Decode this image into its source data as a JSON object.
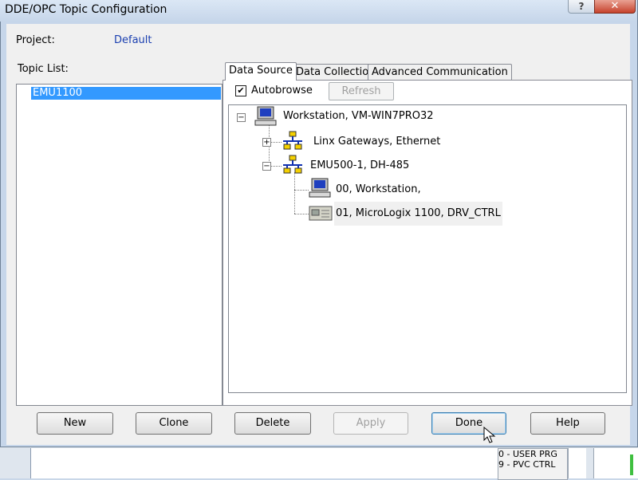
{
  "window": {
    "title": "DDE/OPC Topic Configuration",
    "help_glyph": "?",
    "close_glyph": "✕"
  },
  "project": {
    "label": "Project:",
    "value": "Default"
  },
  "topic_list": {
    "label": "Topic List:",
    "items": [
      "EMU1100"
    ]
  },
  "tabs": [
    {
      "label": "Data Source",
      "selected": true
    },
    {
      "label": "Data Collection",
      "selected": false
    },
    {
      "label": "Advanced Communication",
      "selected": false
    }
  ],
  "data_source": {
    "autobrowse": {
      "label": "Autobrowse",
      "checked": true,
      "check_glyph": "✔"
    },
    "refresh_label": "Refresh"
  },
  "tree": {
    "nodes": [
      {
        "label": "Workstation, VM-WIN7PRO32",
        "icon": "workstation-icon",
        "expander": "−"
      },
      {
        "label": "Linx Gateways, Ethernet",
        "icon": "network-icon",
        "expander": "+"
      },
      {
        "label": "EMU500-1, DH-485",
        "icon": "network-icon",
        "expander": "−"
      },
      {
        "label": "00, Workstation,",
        "icon": "workstation-icon"
      },
      {
        "label": "01, MicroLogix 1100, DRV_CTRL",
        "icon": "plc-icon"
      }
    ]
  },
  "buttons": {
    "new": "New",
    "clone": "Clone",
    "delete": "Delete",
    "apply": "Apply",
    "done": "Done",
    "help": "Help"
  },
  "background_app": {
    "lines": [
      "0 - USER PRG",
      "9 - PVC CTRL"
    ]
  }
}
